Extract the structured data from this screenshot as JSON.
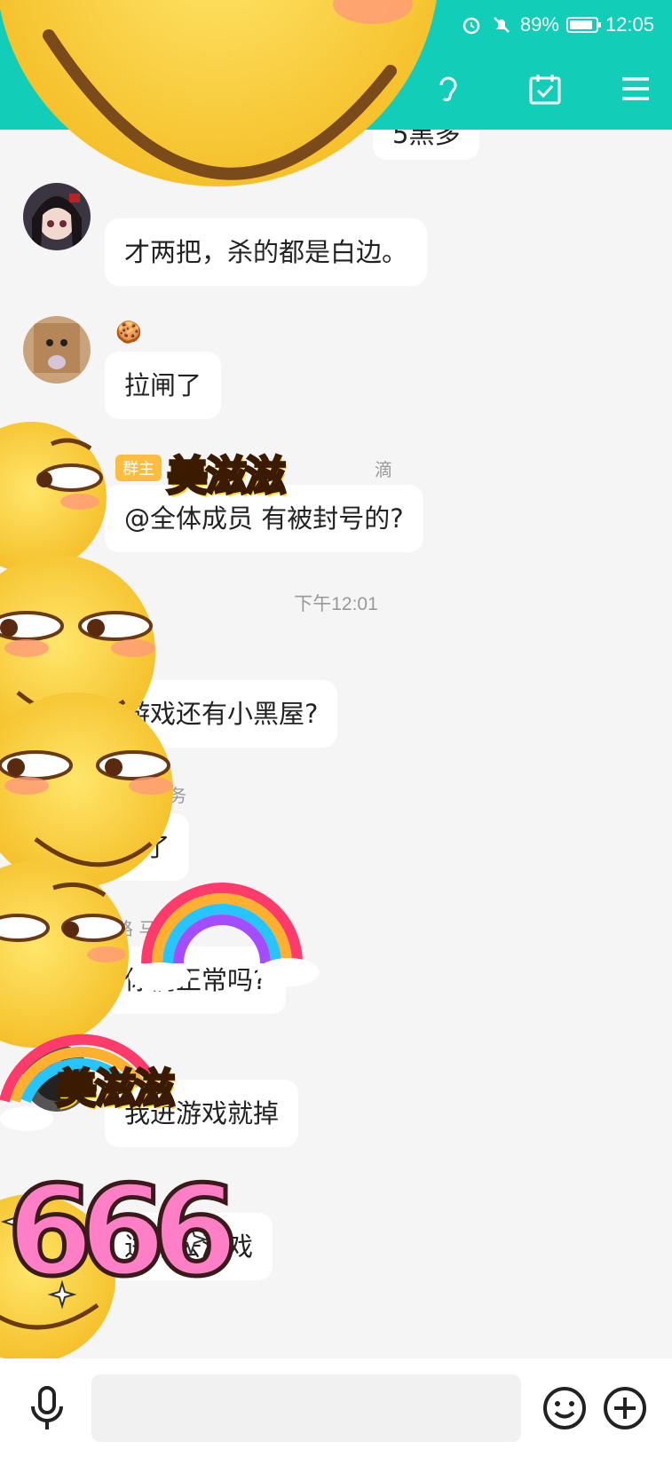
{
  "status_bar": {
    "battery": "89%",
    "time": "12:05",
    "battery_level": 0.89
  },
  "header": {
    "partial_title": "5黑多"
  },
  "messages": [
    {
      "nick": "",
      "text": "才两把，杀的都是白边。"
    },
    {
      "nick": "🍪",
      "text": "拉闸了"
    },
    {
      "badge": "群主",
      "nick": "滴",
      "text": "@全体成员 有被封号的?"
    },
    {
      "timestamp": "下午12:01"
    },
    {
      "nick": "",
      "text": "游戏还有小黑屋?"
    },
    {
      "nick": "务",
      "text": "G了"
    },
    {
      "nick": "路  马",
      "text": "你们正常吗?"
    },
    {
      "nick": "",
      "text": "我进游戏就掉"
    },
    {
      "nick": "",
      "text": "进不去游戏"
    }
  ],
  "stickers": {
    "meizizi": "美滋滋",
    "six": "666"
  },
  "colors": {
    "header": "#12cdb8",
    "bubble": "#ffffff",
    "background": "#f5f5f5",
    "badge": "#ffbd3f"
  },
  "icons": [
    "alarm-icon",
    "mute-icon",
    "battery-icon",
    "ear-icon",
    "calendar-check-icon",
    "menu-icon",
    "microphone-icon",
    "emoji-icon",
    "add-icon"
  ]
}
